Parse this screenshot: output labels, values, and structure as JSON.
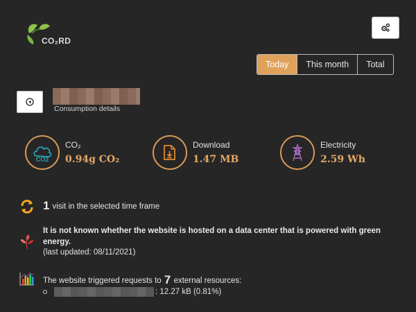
{
  "header": {
    "logo_text": "CO₂RD",
    "settings_icon": "gears-icon"
  },
  "tabs": [
    {
      "label": "Today",
      "active": true
    },
    {
      "label": "This month",
      "active": false
    },
    {
      "label": "Total",
      "active": false
    }
  ],
  "site": {
    "name": "",
    "details_label": "Consumption details",
    "back_icon": "circle-arrow-left-icon"
  },
  "metrics": {
    "co2": {
      "label": "CO₂",
      "value": "0.94g CO₂",
      "icon": "cloud-co2-icon"
    },
    "download": {
      "label": "Download",
      "value": "1.47 MB",
      "icon": "file-download-icon"
    },
    "electricity": {
      "label": "Electricity",
      "value": "2.59 Wh",
      "icon": "power-tower-icon"
    }
  },
  "visits": {
    "count": "1",
    "text": "visit in the selected time frame",
    "icon": "refresh-icon"
  },
  "green_hosting": {
    "text": "It is not known whether the website is hosted on a data center that is powered with green energy.",
    "updated": "(last updated: 08/11/2021)",
    "icon": "leaves-icon"
  },
  "resources": {
    "prefix": "The website triggered requests to",
    "count": "7",
    "suffix": "external resources:",
    "items": [
      {
        "domain": "",
        "size": ": 12.27 kB (0.81%)"
      }
    ],
    "icon": "bar-chart-icon"
  },
  "colors": {
    "accent": "#dfa15a",
    "background": "#262626",
    "value_text": "#e5a865"
  }
}
